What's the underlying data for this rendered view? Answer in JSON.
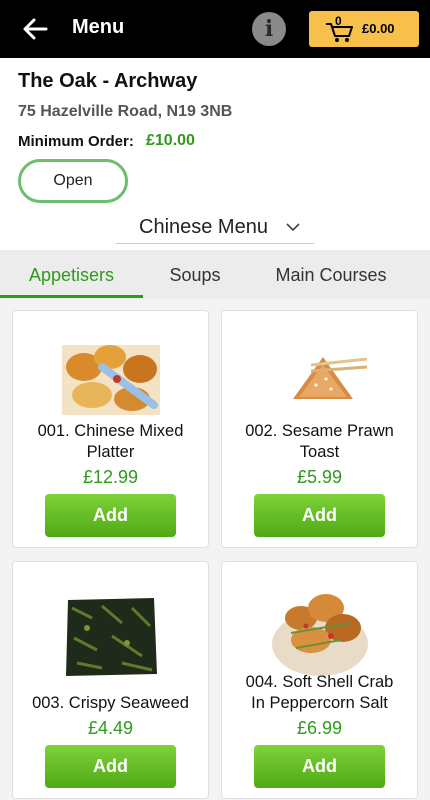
{
  "header": {
    "title": "Menu",
    "back_icon": "arrow-left-icon",
    "info_icon": "info-icon",
    "info_glyph": "i",
    "cart": {
      "count": "0",
      "total": "£0.00",
      "icon": "cart-icon"
    }
  },
  "restaurant": {
    "name": "The Oak - Archway",
    "address": "75 Hazelville Road, N19 3NB",
    "min_order_label": "Minimum Order:",
    "min_order_value": "£10.00",
    "status": "Open"
  },
  "menu_select": {
    "selected": "Chinese Menu"
  },
  "tabs": [
    {
      "label": "Appetisers",
      "active": true
    },
    {
      "label": "Soups",
      "active": false
    },
    {
      "label": "Main Courses",
      "active": false
    }
  ],
  "products": [
    {
      "name_line1": "001. Chinese Mixed",
      "name_line2": "Platter",
      "price": "£12.99",
      "button": "Add"
    },
    {
      "name_line1": "002. Sesame Prawn",
      "name_line2": "Toast",
      "price": "£5.99",
      "button": "Add"
    },
    {
      "name_line1": "003. Crispy Seaweed",
      "name_line2": "",
      "price": "£4.49",
      "button": "Add"
    },
    {
      "name_line1": "004. Soft Shell Crab",
      "name_line2": "In Peppercorn Salt",
      "price": "£6.99",
      "button": "Add"
    }
  ],
  "colors": {
    "accent_green": "#2f9a1c",
    "cart_yellow": "#f7c04a",
    "topbar": "#000000"
  }
}
